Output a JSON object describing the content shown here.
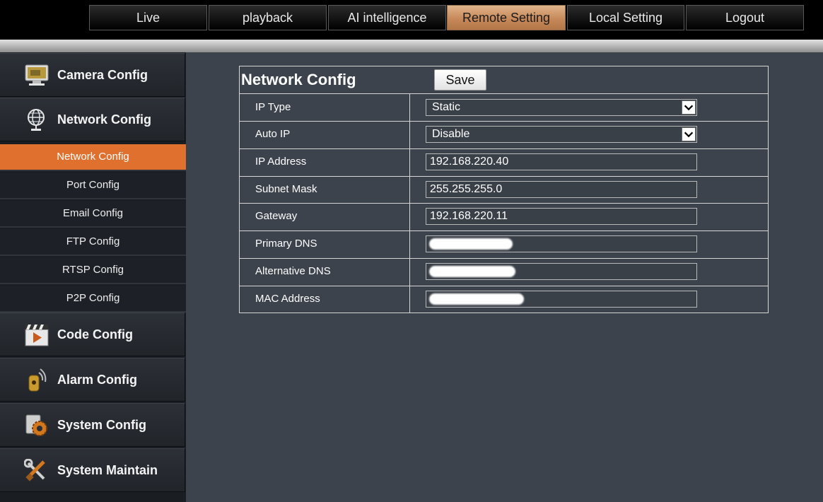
{
  "nav": {
    "tabs": [
      {
        "label": "Live"
      },
      {
        "label": "playback"
      },
      {
        "label": "AI intelligence"
      },
      {
        "label": "Remote Setting"
      },
      {
        "label": "Local Setting"
      },
      {
        "label": "Logout"
      }
    ],
    "active": "Remote Setting"
  },
  "sidebar": {
    "categories": [
      {
        "label": "Camera Config",
        "icon": "monitor-icon"
      },
      {
        "label": "Network Config",
        "icon": "globe-network-icon"
      },
      {
        "label": "Code Config",
        "icon": "clapperboard-play-icon"
      },
      {
        "label": "Alarm Config",
        "icon": "alarm-signal-icon"
      },
      {
        "label": "System Config",
        "icon": "gear-settings-icon"
      },
      {
        "label": "System Maintain",
        "icon": "wrench-tools-icon"
      }
    ],
    "subitems": [
      {
        "label": "Network Config"
      },
      {
        "label": "Port Config"
      },
      {
        "label": "Email Config"
      },
      {
        "label": "FTP Config"
      },
      {
        "label": "RTSP Config"
      },
      {
        "label": "P2P Config"
      }
    ],
    "active_subitem": "Network Config"
  },
  "panel": {
    "title": "Network Config",
    "save_label": "Save",
    "rows": [
      {
        "label": "IP Type",
        "value": "Static",
        "kind": "select"
      },
      {
        "label": "Auto IP",
        "value": "Disable",
        "kind": "select"
      },
      {
        "label": "IP Address",
        "value": "192.168.220.40",
        "kind": "text"
      },
      {
        "label": "Subnet Mask",
        "value": "255.255.255.0",
        "kind": "text"
      },
      {
        "label": "Gateway",
        "value": "192.168.220.11",
        "kind": "text"
      },
      {
        "label": "Primary DNS",
        "value": "",
        "kind": "redacted"
      },
      {
        "label": "Alternative DNS",
        "value": "",
        "kind": "redacted"
      },
      {
        "label": "MAC Address",
        "value": "",
        "kind": "redacted"
      }
    ]
  },
  "colors": {
    "active_tab": "#c7895a",
    "active_subitem": "#e0702e",
    "background": "#3d434c"
  }
}
